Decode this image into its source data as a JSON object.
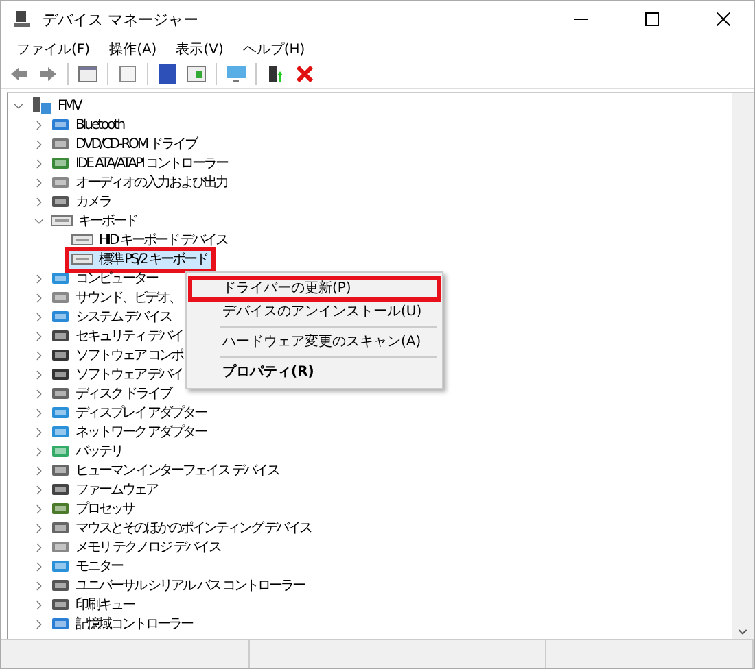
{
  "window": {
    "title": "デバイス マネージャー"
  },
  "menu": [
    "ファイル(F)",
    "操作(A)",
    "表示(V)",
    "ヘルプ(H)"
  ],
  "tree": [
    {
      "label": "FMV",
      "expanded": true,
      "selected": false,
      "highlighted": false,
      "children": [
        {
          "label": "Bluetooth",
          "expanded": false,
          "selected": false,
          "highlighted": false
        },
        {
          "label": "DVD/CD-ROM ドライブ",
          "expanded": false,
          "selected": false,
          "highlighted": false
        },
        {
          "label": "IDE ATA/ATAPI コントローラー",
          "expanded": false,
          "selected": false,
          "highlighted": false
        },
        {
          "label": "オーディオの入力および出力",
          "expanded": false,
          "selected": false,
          "highlighted": false
        },
        {
          "label": "カメラ",
          "expanded": false,
          "selected": false,
          "highlighted": false
        },
        {
          "label": "キーボード",
          "expanded": true,
          "selected": false,
          "highlighted": false,
          "children": [
            {
              "label": "HID キーボード デバイス",
              "selected": false,
              "highlighted": false
            },
            {
              "label": "標準 PS/2 キーボード",
              "selected": true,
              "highlighted": true
            }
          ]
        },
        {
          "label": "コンピューター",
          "expanded": false,
          "selected": false,
          "highlighted": false
        },
        {
          "label": "サウンド、ビデオ、",
          "expanded": false,
          "selected": false,
          "highlighted": false
        },
        {
          "label": "システム デバイス",
          "expanded": false,
          "selected": false,
          "highlighted": false
        },
        {
          "label": "セキュリティ デバイ",
          "expanded": false,
          "selected": false,
          "highlighted": false
        },
        {
          "label": "ソフトウェア コンポ",
          "expanded": false,
          "selected": false,
          "highlighted": false
        },
        {
          "label": "ソフトウェア デバイ",
          "expanded": false,
          "selected": false,
          "highlighted": false
        },
        {
          "label": "ディスク ドライブ",
          "expanded": false,
          "selected": false,
          "highlighted": false
        },
        {
          "label": "ディスプレイ アダプター",
          "expanded": false,
          "selected": false,
          "highlighted": false
        },
        {
          "label": "ネットワーク アダプター",
          "expanded": false,
          "selected": false,
          "highlighted": false
        },
        {
          "label": "バッテリ",
          "expanded": false,
          "selected": false,
          "highlighted": false
        },
        {
          "label": "ヒューマン インターフェイス デバイス",
          "expanded": false,
          "selected": false,
          "highlighted": false
        },
        {
          "label": "ファームウェア",
          "expanded": false,
          "selected": false,
          "highlighted": false
        },
        {
          "label": "プロセッサ",
          "expanded": false,
          "selected": false,
          "highlighted": false
        },
        {
          "label": "マウスとそのほかのポインティング デバイス",
          "expanded": false,
          "selected": false,
          "highlighted": false
        },
        {
          "label": "メモリ テクノロジ デバイス",
          "expanded": false,
          "selected": false,
          "highlighted": false
        },
        {
          "label": "モニター",
          "expanded": false,
          "selected": false,
          "highlighted": false
        },
        {
          "label": "ユニバーサル シリアル バス コントローラー",
          "expanded": false,
          "selected": false,
          "highlighted": false
        },
        {
          "label": "印刷キュー",
          "expanded": false,
          "selected": false,
          "highlighted": false
        },
        {
          "label": "記憶域コントローラー",
          "expanded": false,
          "selected": false,
          "highlighted": false
        }
      ]
    }
  ],
  "context_menu": [
    {
      "kind": "item",
      "label": "ドライバーの更新(P)",
      "bold": false,
      "highlighted": true
    },
    {
      "kind": "item",
      "label": "デバイスのアンインストール(U)",
      "bold": false,
      "highlighted": false
    },
    {
      "kind": "separator"
    },
    {
      "kind": "item",
      "label": "ハードウェア変更のスキャン(A)",
      "bold": false,
      "highlighted": false
    },
    {
      "kind": "separator"
    },
    {
      "kind": "item",
      "label": "プロパティ(R)",
      "bold": true,
      "highlighted": false
    }
  ]
}
